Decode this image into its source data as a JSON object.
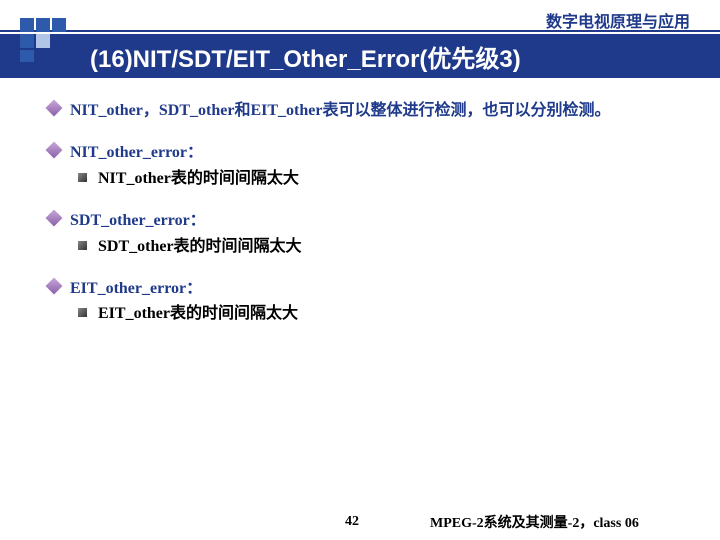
{
  "header": {
    "course": "数字电视原理与应用"
  },
  "title": "(16)NIT/SDT/EIT_Other_Error(优先级3)",
  "bullets": [
    {
      "text": "NIT_other，SDT_other和EIT_other表可以整体进行检测，也可以分别检测。",
      "subs": []
    },
    {
      "text": "NIT_other_error：",
      "subs": [
        "NIT_other表的时间间隔太大"
      ]
    },
    {
      "text": "SDT_other_error：",
      "subs": [
        "SDT_other表的时间间隔太大"
      ]
    },
    {
      "text": "EIT_other_error：",
      "subs": [
        "EIT_other表的时间间隔太大"
      ]
    }
  ],
  "footer": {
    "page": "42",
    "text": "MPEG-2系统及其测量-2，class 06"
  }
}
